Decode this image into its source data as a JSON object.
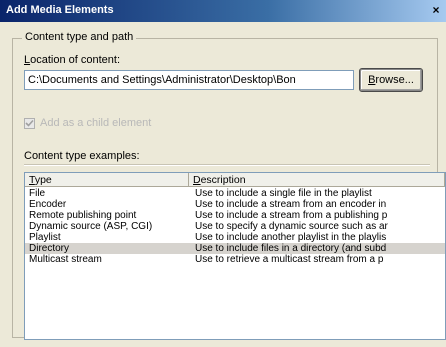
{
  "window": {
    "title": "Add Media Elements",
    "close_glyph": "×"
  },
  "content_group": {
    "legend": "Content type and path",
    "location_label_accel": "L",
    "location_label_rest": "ocation of content:",
    "path_value": "C:\\Documents and Settings\\Administrator\\Desktop\\Bon",
    "browse_accel": "B",
    "browse_rest": "rowse...",
    "checkbox_label": "Add as a child element",
    "checkbox_checked": true
  },
  "examples": {
    "label": "Content type examples:",
    "columns": {
      "type_accel": "T",
      "type_rest": "ype",
      "description_accel": "D",
      "description_rest": "escription"
    },
    "rows": [
      {
        "type": "File",
        "description": "Use to include a single file in the playlist"
      },
      {
        "type": "Encoder",
        "description": "Use to include a stream from an encoder in"
      },
      {
        "type": "Remote publishing point",
        "description": "Use to include a stream from a publishing p"
      },
      {
        "type": "Dynamic source (ASP, CGI)",
        "description": "Use to specify a dynamic source such as ar"
      },
      {
        "type": "Playlist",
        "description": "Use to include another playlist in the playlis"
      },
      {
        "type": "Directory",
        "description": "Use to include files in a directory (and subd"
      },
      {
        "type": "Multicast stream",
        "description": "Use to retrieve a multicast stream from a p"
      }
    ],
    "selected_index": 5
  }
}
